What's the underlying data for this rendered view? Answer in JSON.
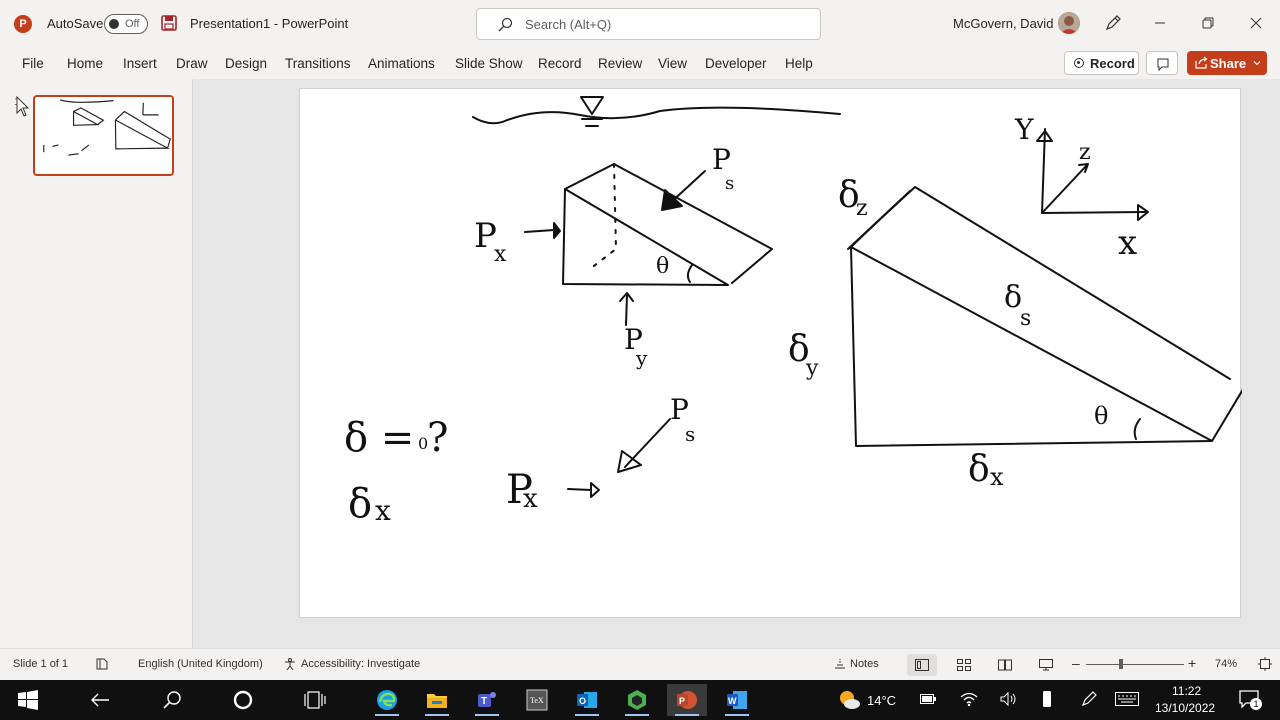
{
  "titlebar": {
    "autosave_label": "AutoSave",
    "autosave_state": "Off",
    "doc_title": "Presentation1  -  PowerPoint",
    "search_placeholder": "Search (Alt+Q)",
    "user_name": "McGovern, David"
  },
  "menu": {
    "items": [
      "File",
      "Home",
      "Insert",
      "Draw",
      "Design",
      "Transitions",
      "Animations",
      "Slide Show",
      "Record",
      "Review",
      "View",
      "Developer",
      "Help"
    ],
    "record_label": "Record",
    "share_label": "Share"
  },
  "thumbnails": {
    "slide_number": "1"
  },
  "slide": {
    "labels": {
      "px_top": "P",
      "px_top_sub": "x",
      "ps_top": "P",
      "ps_top_sub": "s",
      "py": "P",
      "py_sub": "y",
      "theta_small": "θ",
      "delta_z": "δ",
      "delta_z_sub": "z",
      "delta_s": "δ",
      "delta_s_sub": "s",
      "delta_y": "δ",
      "delta_y_sub": "y",
      "delta_x_big": "δ",
      "delta_x_big_sub": "x",
      "theta_big": "θ",
      "axis_y": "Y",
      "axis_z": "z",
      "axis_x": "x",
      "delta_question": "δ = ?",
      "delta_question_sub": "0",
      "delta_x_left": "δ",
      "delta_x_left_sub": "x",
      "px_bottom": "P",
      "px_bottom_sub": "x",
      "ps_bottom": "P",
      "ps_bottom_sub": "s"
    }
  },
  "status": {
    "slide_info": "Slide 1 of 1",
    "language": "English (United Kingdom)",
    "accessibility": "Accessibility: Investigate",
    "notes_label": "Notes",
    "zoom_level": "74%"
  },
  "taskbar": {
    "weather_temp": "14°C",
    "time": "11:22",
    "date": "13/10/2022",
    "notification_count": "1"
  },
  "colors": {
    "brand": "#c43e1c"
  }
}
